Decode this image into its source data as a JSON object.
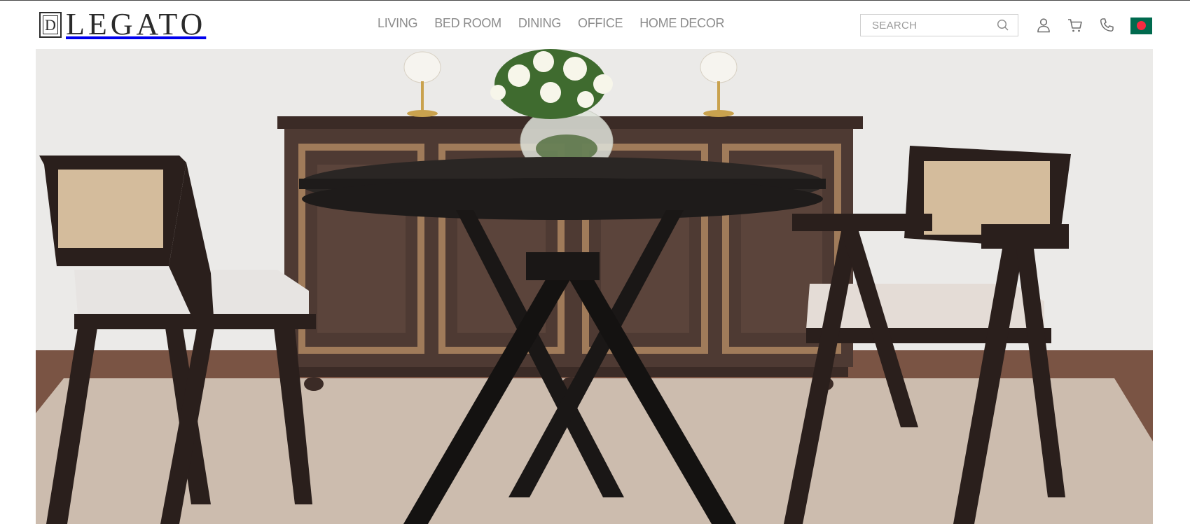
{
  "brand": {
    "logo_text": "LEGATO",
    "logo_monogram": "D"
  },
  "nav": {
    "items": [
      {
        "label": "LIVING"
      },
      {
        "label": "BED ROOM"
      },
      {
        "label": "DINING"
      },
      {
        "label": "OFFICE"
      },
      {
        "label": "HOME DECOR"
      }
    ]
  },
  "search": {
    "placeholder": "SEARCH",
    "icon": "search-icon"
  },
  "actions": {
    "account_icon": "user-icon",
    "cart_icon": "cart-icon",
    "phone_icon": "phone-icon",
    "flag": "bangladesh-flag-icon"
  },
  "hero": {
    "image": "dining-room-hero-image",
    "colors": {
      "wall": "#eeedeb",
      "floor": "#7a5444",
      "rug": "#d2c2b4",
      "wood_dark": "#2a1f1c",
      "sideboard": "#4e3a33",
      "cane": "#c9ab86",
      "cushion": "#e7e4e2"
    }
  }
}
